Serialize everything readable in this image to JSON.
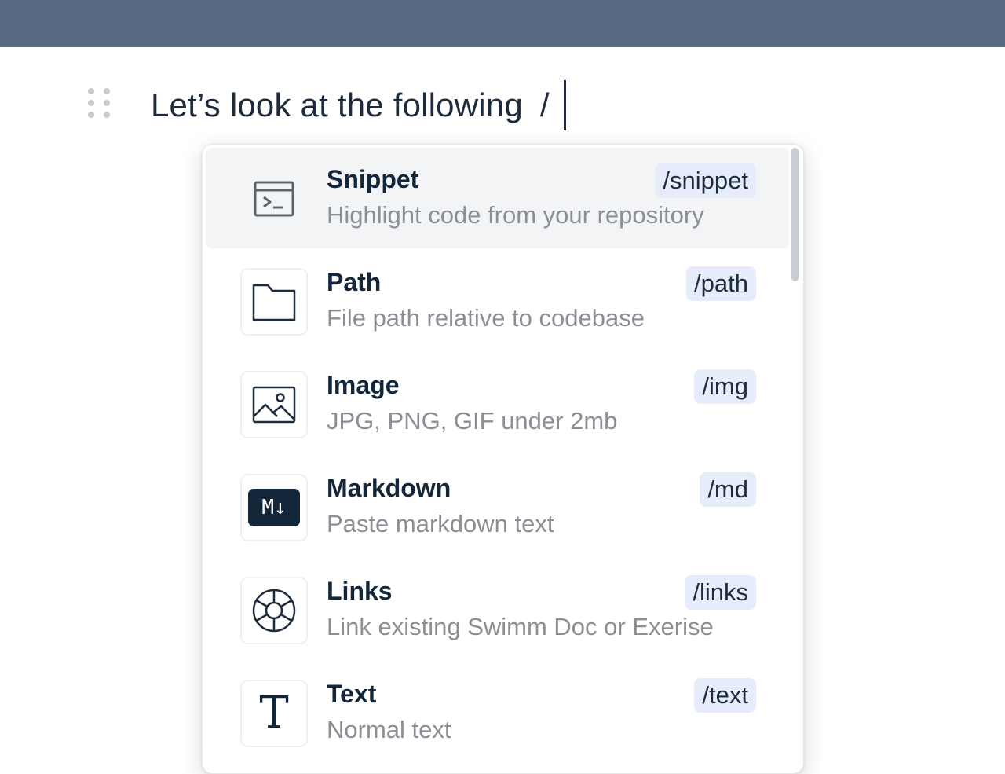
{
  "editor": {
    "text": "Let’s look at the following",
    "slash": "/"
  },
  "menu": {
    "items": [
      {
        "title": "Snippet",
        "command": "/snippet",
        "description": "Highlight code from your repository",
        "icon": "terminal-icon"
      },
      {
        "title": "Path",
        "command": "/path",
        "description": "File path relative to codebase",
        "icon": "folder-icon"
      },
      {
        "title": "Image",
        "command": "/img",
        "description": "JPG, PNG, GIF under 2mb",
        "icon": "image-icon"
      },
      {
        "title": "Markdown",
        "command": "/md",
        "description": "Paste markdown text",
        "icon": "markdown-icon",
        "icon_text": "M↓"
      },
      {
        "title": "Links",
        "command": "/links",
        "description": "Link existing Swimm Doc or Exerise",
        "icon": "lifebuoy-icon"
      },
      {
        "title": "Text",
        "command": "/text",
        "description": "Normal text",
        "icon": "text-icon",
        "icon_text": "T"
      }
    ]
  },
  "colors": {
    "topbar": "#566882",
    "text_primary": "#14263a",
    "text_secondary": "#8b8f95",
    "command_badge": "#e7ecfb",
    "active_row": "#f3f4f6"
  }
}
